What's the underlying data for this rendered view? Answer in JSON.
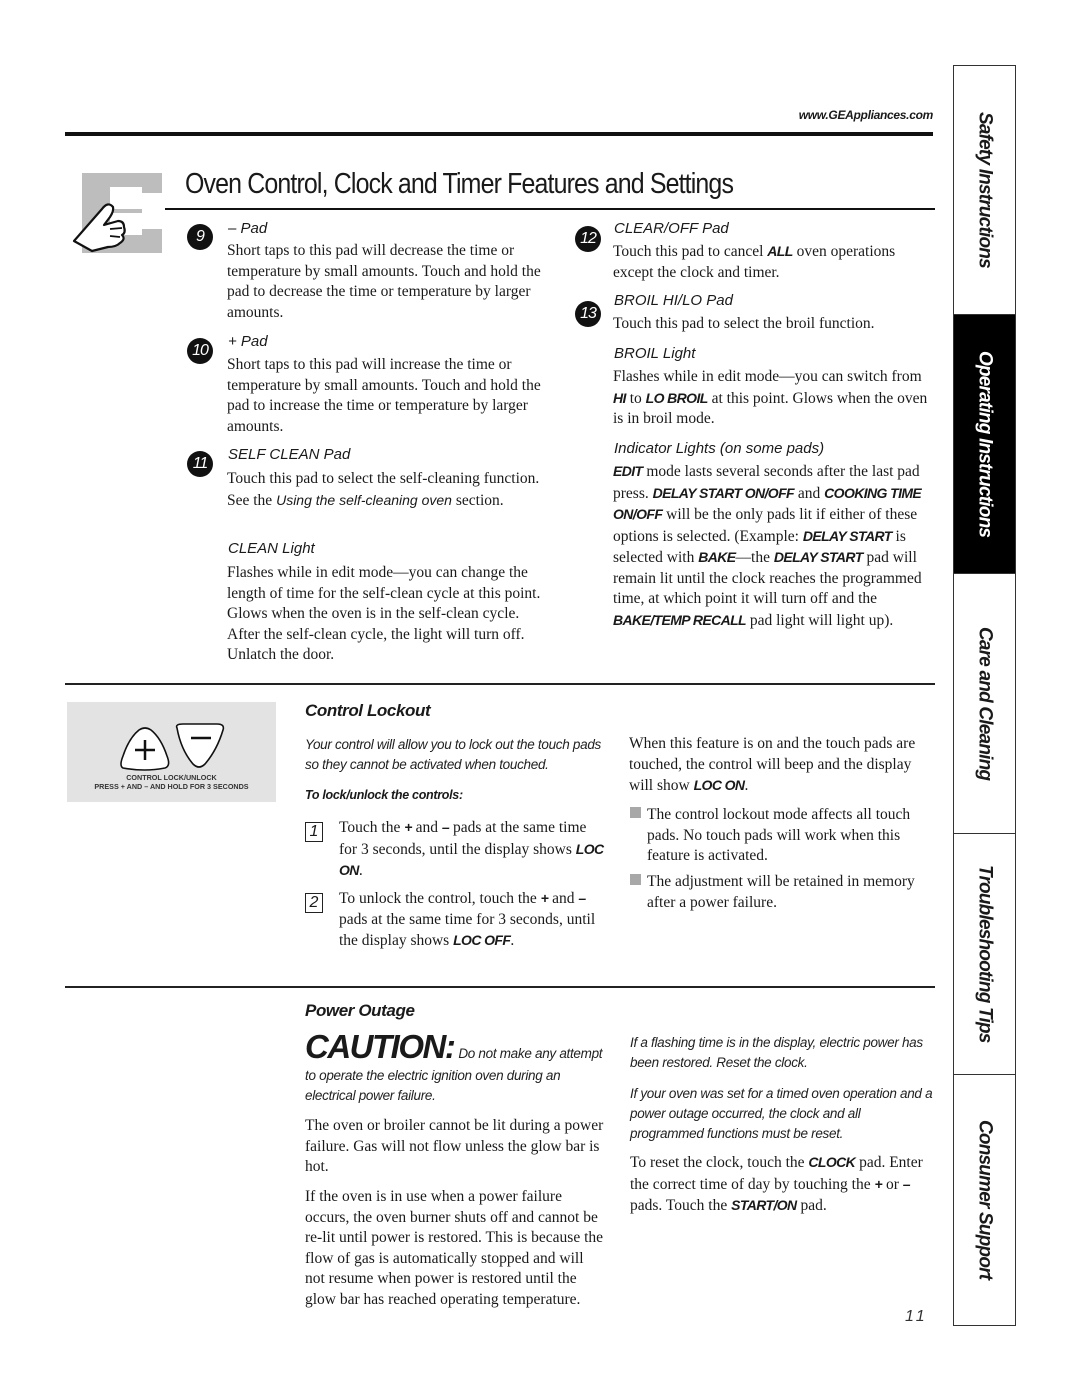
{
  "header": {
    "url": "www.GEAppliances.com",
    "title": "Oven Control, Clock and Timer Features and Settings"
  },
  "features": [
    {
      "number": "9",
      "heading": "– Pad",
      "text": "Short taps to this pad will decrease the time or temperature by small amounts. Touch and hold the pad to decrease the time or temperature by larger amounts."
    },
    {
      "number": "10",
      "heading": "+ Pad",
      "text": "Short taps to this pad will increase the time or temperature by small amounts. Touch and hold the pad to increase the time or temperature by larger amounts."
    },
    {
      "number": "11",
      "heading": "SELF CLEAN Pad",
      "text_before": "Touch this pad to select the self-cleaning function. See the ",
      "text_italic": "Using the self-cleaning oven",
      "text_after": " section.",
      "sub_heading": "CLEAN Light",
      "sub_text": "Flashes while in edit mode—you can change the length of time for the self-clean cycle at this point. Glows when the oven is in the self-clean cycle. After the self-clean cycle, the light will turn off. Unlatch the door."
    },
    {
      "number": "12",
      "heading": "CLEAR/OFF Pad",
      "text_before": "Touch this pad to cancel ",
      "text_bold": "ALL",
      "text_after": " oven operations except the clock and timer."
    },
    {
      "number": "13",
      "heading": "BROIL HI/LO Pad",
      "text": "Touch this pad to select the broil function.",
      "sub_heading": "BROIL Light",
      "sub_text_1": "Flashes while in edit mode—you can switch from ",
      "sub_bold_1": "HI",
      "sub_text_2": " to ",
      "sub_bold_2": "LO BROIL",
      "sub_text_3": " at this point. Glows when the oven is in broil mode."
    }
  ],
  "indicator": {
    "heading": "Indicator Lights (on some pads)",
    "b1": "EDIT",
    "t1": " mode lasts several seconds after the last pad press. ",
    "b2": "DELAY START ON/OFF",
    "t2": " and ",
    "b3": "COOKING TIME ON/OFF",
    "t3": " will be the only pads lit if either of these options is selected. (Example: ",
    "b4": "DELAY START",
    "t4": " is selected with ",
    "b5": "BAKE",
    "t5": "—the ",
    "b6": "DELAY START",
    "t6": " pad will remain lit until the clock reaches the programmed time, at which point it will turn off and the ",
    "b7": "BAKE/TEMP RECALL",
    "t7": " pad light will light up)."
  },
  "control_lockout": {
    "image": {
      "plus_symbol": "+",
      "minus_symbol": "–",
      "caption_1": "CONTROL LOCK/UNLOCK",
      "caption_2": "PRESS + AND – AND HOLD FOR 3 SECONDS"
    },
    "title": "Control Lockout",
    "intro": "Your control will allow you to lock out the touch pads so they cannot be activated when touched.",
    "steps_heading": "To lock/unlock the controls:",
    "steps": [
      {
        "number": "1",
        "t1": "Touch the ",
        "b1": "+",
        "t2": " and ",
        "b2": "–",
        "t3": " pads at the same time for 3 seconds, until the display shows ",
        "b3": "LOC ON",
        "t4": "."
      },
      {
        "number": "2",
        "t1": "To unlock the control, touch the ",
        "b1": "+",
        "t2": " and ",
        "b2": "–",
        "t3": " pads at the same time for 3 seconds, until the display shows ",
        "b3": "LOC OFF",
        "t4": "."
      }
    ],
    "right_text": "When this feature is on and the touch pads are touched, the control will beep and the display will show ",
    "right_bold": "LOC ON",
    "right_end": ".",
    "bullets": [
      "The control lockout mode affects all touch pads. No touch pads will work when this feature is activated.",
      "The adjustment will be retained in memory after a power failure."
    ]
  },
  "power_outage": {
    "title": "Power Outage",
    "caution_label": "CAUTION:",
    "caution_text": "Do not make any attempt to operate the electric ignition oven during an electrical power failure.",
    "para1": "The oven or broiler cannot be lit during a power failure. Gas will not flow unless the glow bar is hot.",
    "para2": "If the oven is in use when a power failure occurs, the oven burner shuts off and cannot be re-lit until power is restored. This is because the flow of gas is automatically stopped and will not resume when power is restored until the glow bar has reached operating temperature.",
    "right_italic_1": "If a flashing time is in the display, electric power has been restored. Reset the clock.",
    "right_italic_2": "If your oven was set for a timed oven operation and a power outage occurred, the clock and all programmed functions must be reset.",
    "reset_t1": "To reset the clock, touch the ",
    "reset_b1": "CLOCK",
    "reset_t2": " pad. Enter the correct time of day by touching the ",
    "reset_b2": "+",
    "reset_t3": " or ",
    "reset_b3": "–",
    "reset_t4": " pads. Touch the ",
    "reset_b4": "START/ON",
    "reset_t5": " pad."
  },
  "side_tabs": [
    {
      "label": "Safety Instructions",
      "active": false
    },
    {
      "label": "Operating Instructions",
      "active": true
    },
    {
      "label": "Care and Cleaning",
      "active": false
    },
    {
      "label": "Troubleshooting Tips",
      "active": false
    },
    {
      "label": "Consumer Support",
      "active": false
    }
  ],
  "page_number": "11",
  "icons": {
    "header_icon": "hand-pressing-pad-icon",
    "bullet": "square-bullet-icon"
  }
}
